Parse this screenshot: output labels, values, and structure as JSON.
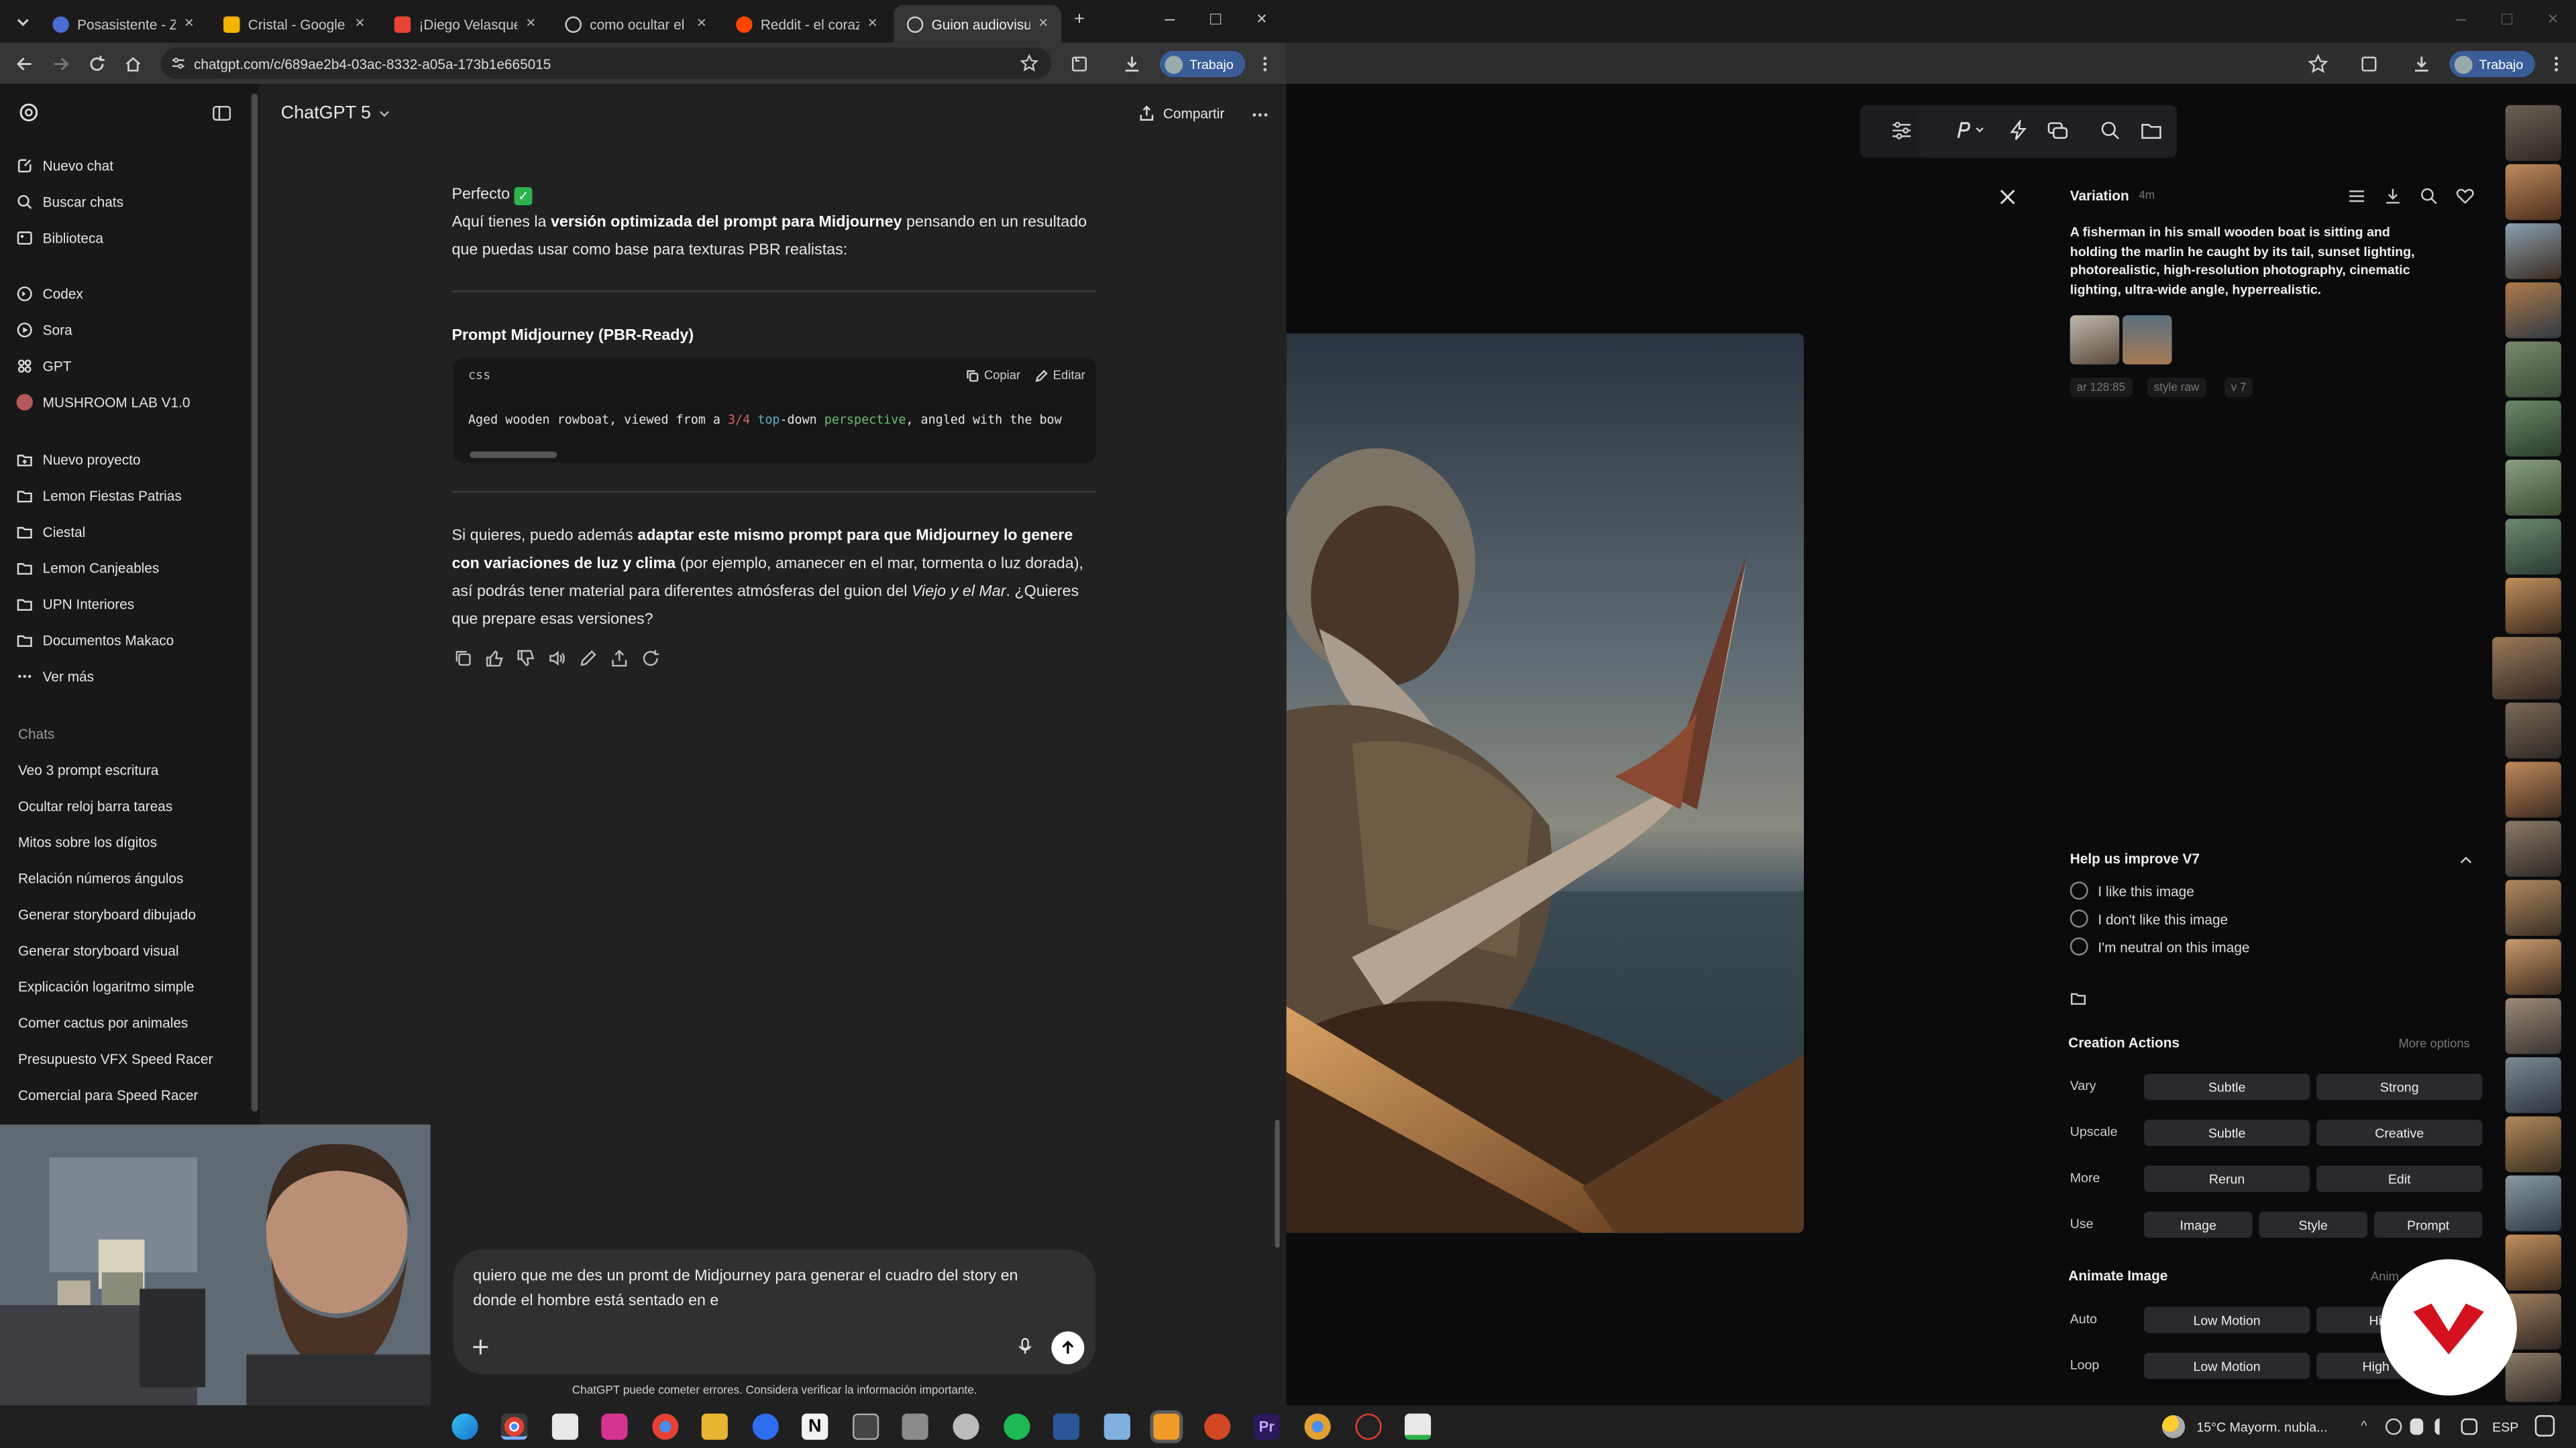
{
  "browser_left": {
    "tabs": [
      {
        "label": "Posasistente - Zo",
        "color": "#4a6cd4"
      },
      {
        "label": "Cristal - Google Sl",
        "color": "#f4b400"
      },
      {
        "label": "¡Diego Velasquez",
        "color": "#ea4335"
      },
      {
        "label": "como ocultar el re",
        "color": "#cfcfcf"
      },
      {
        "label": "Reddit - el corazó",
        "color": "#ff4500"
      },
      {
        "label": "Guion audiovisual",
        "color": "#cfcfcf"
      }
    ],
    "url": "chatgpt.com/c/689ae2b4-03ac-8332-a05a-173b1e665015",
    "profile_label": "Trabajo"
  },
  "sidebar": {
    "top_items": [
      {
        "label": "Nuevo chat",
        "icon": "new-chat-icon"
      },
      {
        "label": "Buscar chats",
        "icon": "search-icon"
      },
      {
        "label": "Biblioteca",
        "icon": "library-icon"
      }
    ],
    "gpt_items": [
      {
        "label": "Codex",
        "icon": "codex-icon"
      },
      {
        "label": "Sora",
        "icon": "sora-icon"
      },
      {
        "label": "GPT",
        "icon": "gpt-icon"
      },
      {
        "label": "MUSHROOM LAB V1.0",
        "icon": "mushroom-avatar-icon"
      }
    ],
    "projects": [
      {
        "label": "Nuevo proyecto",
        "icon": "new-folder-icon"
      },
      {
        "label": "Lemon Fiestas Patrias",
        "icon": "folder-icon"
      },
      {
        "label": "Ciestal",
        "icon": "folder-icon"
      },
      {
        "label": "Lemon Canjeables",
        "icon": "folder-icon"
      },
      {
        "label": "UPN Interiores",
        "icon": "folder-icon"
      },
      {
        "label": "Documentos Makaco",
        "icon": "folder-icon"
      },
      {
        "label": "Ver más",
        "icon": "more-icon"
      }
    ],
    "chats_heading": "Chats",
    "chats": [
      "Veo 3 prompt escritura",
      "Ocultar reloj barra tareas",
      "Mitos sobre los dígitos",
      "Relación números ángulos",
      "Generar storyboard dibujado",
      "Generar storyboard visual",
      "Explicación logaritmo simple",
      "Comer cactus por animales",
      "Presupuesto VFX Speed Racer",
      "Comercial para Speed Racer"
    ]
  },
  "chat": {
    "model": "ChatGPT 5",
    "share": "Compartir",
    "intro_1": "Perfecto",
    "intro_2a": "Aquí tienes la ",
    "intro_2b": "versión optimizada del prompt para Midjourney",
    "intro_2c": " pensando en un resultado que puedas usar como base para texturas PBR realistas:",
    "section_title": "Prompt Midjourney (PBR-Ready)",
    "code_lang": "css",
    "copy": "Copiar",
    "edit": "Editar",
    "code_a": "Aged wooden rowboat, viewed from a ",
    "code_num": "3/4",
    "code_kw": "top",
    "code_b": "-down ",
    "code_grn": "perspective",
    "code_c": ", angled with the bow",
    "follow_1": "Si quieres, puedo además ",
    "follow_2": "adaptar este mismo prompt para que Midjourney lo genere con variaciones de luz y clima",
    "follow_3": " (por ejemplo, amanecer en el mar, tormenta o luz dorada), así podrás tener material para diferentes atmósferas del guion del ",
    "follow_4": "Viejo y el Mar",
    "follow_5": ". ¿Quieres que prepare esas versiones?",
    "composer_text": "quiero que me des un promt de Midjourney para generar el cuadro del story en donde el hombre está sentado en e",
    "disclaimer": "ChatGPT puede cometer errores. Considera verificar la información importante."
  },
  "midjourney": {
    "profile_label": "Trabajo",
    "panel_title": "Variation",
    "panel_time": "4m",
    "prompt": "A fisherman in his small wooden boat is sitting and holding the marlin he caught by its tail, sunset lighting, photorealistic, high-resolution photography, cinematic lighting, ultra-wide angle, hyperrealistic.",
    "chips": [
      "ar 128:85",
      "style raw",
      "v 7"
    ],
    "help_title": "Help us improve V7",
    "feedback": [
      "I like this image",
      "I don't like this image",
      "I'm neutral on this image"
    ],
    "creation_title": "Creation Actions",
    "more_options": "More options",
    "rows": [
      {
        "label": "Vary",
        "buttons": [
          "Subtle",
          "Strong"
        ]
      },
      {
        "label": "Upscale",
        "buttons": [
          "Subtle",
          "Creative"
        ]
      },
      {
        "label": "More",
        "buttons": [
          "Rerun",
          "Edit"
        ]
      },
      {
        "label": "Use",
        "buttons": [
          "Image",
          "Style",
          "Prompt"
        ]
      }
    ],
    "animate_title": "Animate Image",
    "animate_cut": "Anim",
    "animate_rows": [
      {
        "label": "Auto",
        "buttons": [
          "Low Motion",
          "High"
        ]
      },
      {
        "label": "Loop",
        "buttons": [
          "Low Motion",
          "High"
        ]
      }
    ]
  },
  "taskbar": {
    "weather": "15°C  Mayorm. nubla...",
    "lang": "ESP"
  }
}
